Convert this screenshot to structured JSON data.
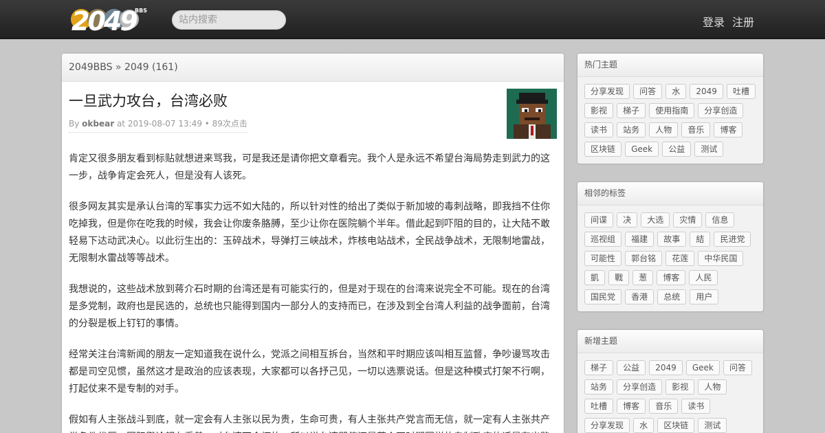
{
  "header": {
    "logo_text": "2049",
    "logo_sub": "BBS",
    "search_placeholder": "站内搜索",
    "login": "登录",
    "register": "注册"
  },
  "breadcrumb": {
    "site": "2049BBS",
    "sep": " » ",
    "node": "2049 (161)"
  },
  "post": {
    "title": "一旦武力攻台，台湾必败",
    "by": "By ",
    "author": "okbear",
    "meta_rest": " at 2019-08-07 13:49 • 89次点击",
    "paragraphs": [
      "肯定又很多朋友看到标贴就想进来骂我，可是我还是请你把文章看完。我个人是永远不希望台海局势走到武力的这一步，战争肯定会死人，但是没有人该死。",
      "很多网友其实是承认台湾的军事实力远不如大陆的，所以针对性的给出了类似于新加坡的毒刺战略，即我挡不住你吃掉我，但是你在吃我的时候，我会让你废条胳膊，至少让你在医院躺个半年。借此起到吓阻的目的，让大陆不敢轻易下达动武决心。以此衍生出的：玉碎战术，导弹打三峡战术，炸核电站战术，全民战争战术，无限制地雷战，无限制水雷战等等战术。",
      "我想说的，这些战术放到蒋介石时期的台湾还是有可能实行的，但是对于现在的台湾来说完全不可能。现在的台湾是多党制，政府也是民选的，总统也只能得到国内一部分人的支持而已，在涉及到全台湾人利益的战争面前，台湾的分裂是板上钉钉的事情。",
      "经常关注台湾新闻的朋友一定知道我在说什么，党派之间相互拆台，当然和平时期应该叫相互监督，争吵谩骂攻击都是司空见惯，虽然这才是政治的应该表现，大家都可以各抒己见，一切以选票说话。但是这种模式打架不行啊，打起仗来不是专制的对手。",
      "假如有人主张战斗到底，就一定会有人主张以民为贵，生命可贵，有人主张共产党言而无信，就一定有人主张共产党条件优厚。国际舆论都在看着，对台湾不会坏的，所以说台湾即使还是蒋介石时期同样的专制政府的话是有出路"
    ]
  },
  "sidebar": {
    "hot": {
      "title": "热门主题",
      "tags": [
        "分享发现",
        "问答",
        "水",
        "2049",
        "吐槽",
        "影视",
        "梯子",
        "使用指南",
        "分享创造",
        "读书",
        "站务",
        "人物",
        "音乐",
        "博客",
        "区块链",
        "Geek",
        "公益",
        "测试"
      ]
    },
    "related": {
      "title": "相邻的标签",
      "tags": [
        "间谍",
        "决",
        "大选",
        "灾情",
        "信息",
        "巡视组",
        "福建",
        "故事",
        "結",
        "民进党",
        "可能性",
        "郭台铭",
        "花莲",
        "中华民国",
        "凱",
        "戰",
        "葱",
        "博客",
        "人民",
        "国民党",
        "香港",
        "总统",
        "用户"
      ]
    },
    "new": {
      "title": "新增主题",
      "tags": [
        "梯子",
        "公益",
        "2049",
        "Geek",
        "问答",
        "站务",
        "分享创造",
        "影视",
        "人物",
        "吐槽",
        "博客",
        "音乐",
        "读书",
        "分享发现",
        "水",
        "区块链",
        "测试"
      ]
    }
  },
  "colors": {
    "topbar": "#2b2b2b",
    "avatar_bg": "#1e6b52",
    "page_bg": "#c8c8c8"
  }
}
